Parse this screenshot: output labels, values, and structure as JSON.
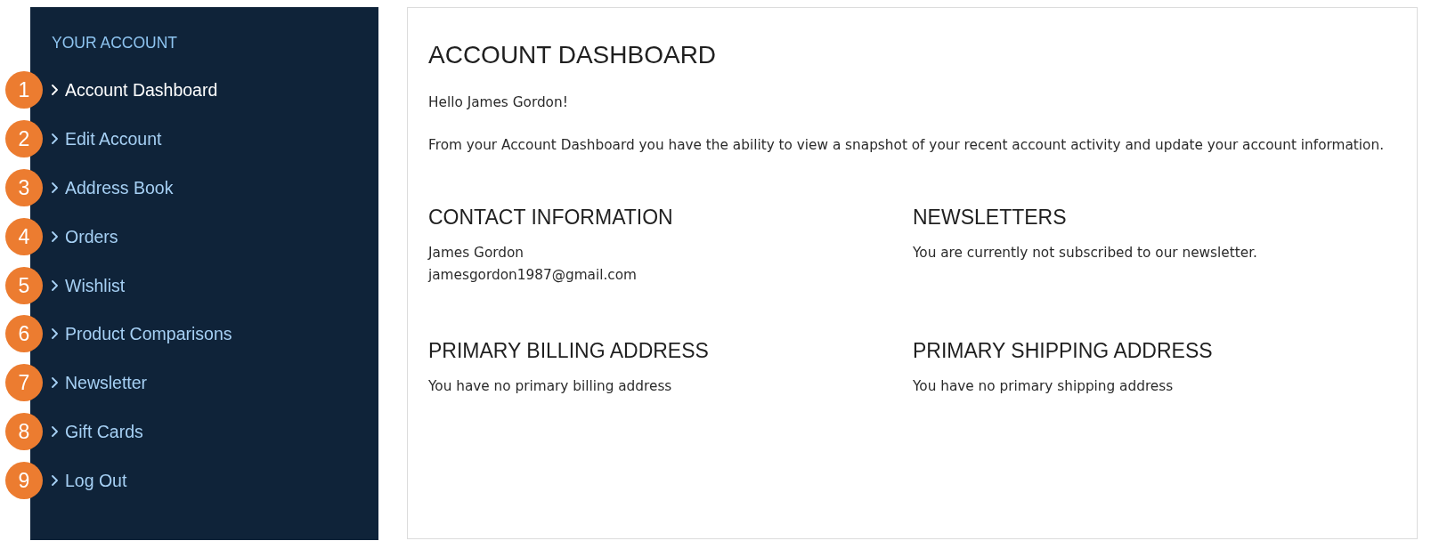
{
  "sidebar": {
    "heading": "YOUR ACCOUNT",
    "items": [
      {
        "badge": "1",
        "label": "Account Dashboard",
        "selected": true
      },
      {
        "badge": "2",
        "label": "Edit Account",
        "selected": false
      },
      {
        "badge": "3",
        "label": "Address Book",
        "selected": false
      },
      {
        "badge": "4",
        "label": "Orders",
        "selected": false
      },
      {
        "badge": "5",
        "label": "Wishlist",
        "selected": false
      },
      {
        "badge": "6",
        "label": "Product Comparisons",
        "selected": false
      },
      {
        "badge": "7",
        "label": "Newsletter",
        "selected": false
      },
      {
        "badge": "8",
        "label": "Gift Cards",
        "selected": false
      },
      {
        "badge": "9",
        "label": "Log Out",
        "selected": false
      }
    ]
  },
  "main": {
    "title": "ACCOUNT DASHBOARD",
    "greeting": "Hello James Gordon!",
    "intro": "From your Account Dashboard you have the ability to view a snapshot of your recent account activity and update your account information.",
    "sections": [
      {
        "heading": "CONTACT INFORMATION",
        "lines": [
          "James Gordon",
          "jamesgordon1987@gmail.com"
        ]
      },
      {
        "heading": "NEWSLETTERS",
        "lines": [
          "You are currently not subscribed to our newsletter."
        ]
      },
      {
        "heading": "PRIMARY BILLING ADDRESS",
        "lines": [
          "You have no primary billing address"
        ]
      },
      {
        "heading": "PRIMARY SHIPPING ADDRESS",
        "lines": [
          "You have no primary shipping address"
        ]
      }
    ]
  }
}
